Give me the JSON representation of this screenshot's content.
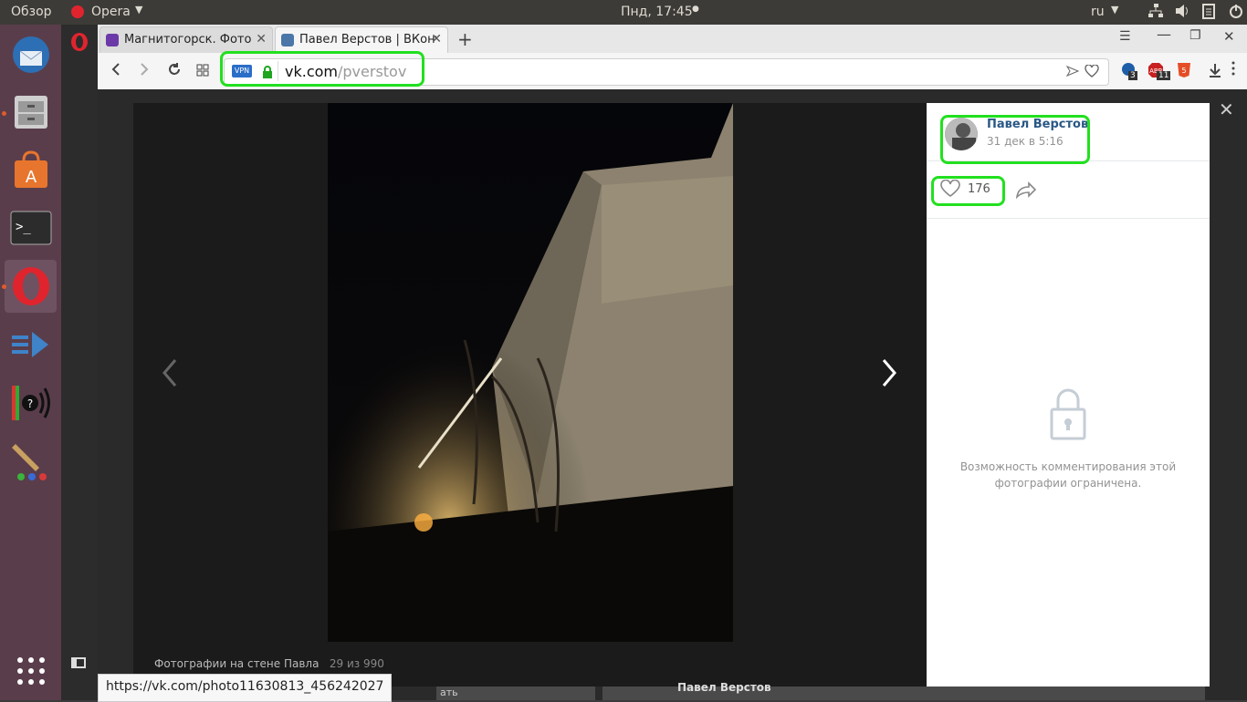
{
  "top_panel": {
    "overview": "Обзор",
    "app": "Opera",
    "clock": "Пнд, 17:45",
    "lang": "ru"
  },
  "tabs": [
    {
      "title": "Магнитогорск. Фото",
      "fav_color": "#6c3aa8"
    },
    {
      "title": "Павел Верстов | ВКонтакте",
      "fav_color": "#4a76a8"
    }
  ],
  "address": {
    "vpn": "VPN",
    "host": "vk.com",
    "path": "/pverstov"
  },
  "extensions": {
    "badge1": "3",
    "badge2": "11",
    "abp": "ABP"
  },
  "viewer": {
    "caption": "Фотографии на стене Павла",
    "counter": "29 из 990",
    "status_url": "https://vk.com/photo11630813_456242027"
  },
  "post": {
    "author": "Павел Верстов",
    "date": "31 дек в 5:16",
    "likes": "176",
    "comments_locked": "Возможность комментирования этой фотографии ограничена."
  },
  "below_fold": {
    "author": "Павел Верстов",
    "partial": "ать"
  },
  "colors": {
    "highlight": "#22e01f",
    "vk_blue": "#2a5885",
    "launcher": "#5a3d4b"
  }
}
